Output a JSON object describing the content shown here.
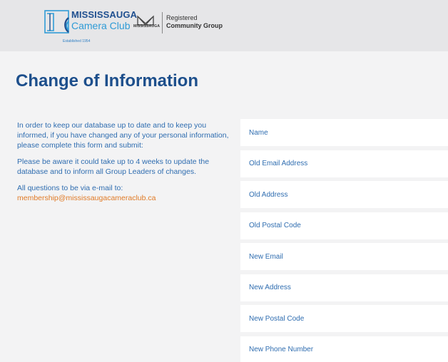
{
  "header": {
    "logo_line1": "MISSISSAUGA",
    "logo_line2": "Camera Club",
    "logo_established": "Established 1954",
    "city_logo_text": "MISSISSAUGA",
    "registered_line1": "Registered",
    "registered_line2": "Community Group"
  },
  "page": {
    "title": "Change of Information"
  },
  "intro": {
    "paragraph1": "In order to keep our database up to date and to keep you informed, if you have changed any of your personal information, please complete this form and submit:",
    "paragraph2": "Please be aware it could take up to 4 weeks to update the database and to inform all Group Leaders of changes.",
    "paragraph3": "All questions to be via e-mail to:",
    "email": "membership@mississaugacameraclub.ca"
  },
  "form": {
    "fields": [
      {
        "placeholder": "Name",
        "value": ""
      },
      {
        "placeholder": "Old Email Address",
        "value": ""
      },
      {
        "placeholder": "Old Address",
        "value": ""
      },
      {
        "placeholder": "Old Postal Code",
        "value": ""
      },
      {
        "placeholder": "New Email",
        "value": ""
      },
      {
        "placeholder": "New Address",
        "value": ""
      },
      {
        "placeholder": "New Postal Code",
        "value": ""
      },
      {
        "placeholder": "New Phone Number",
        "value": ""
      }
    ]
  },
  "colors": {
    "brand_blue": "#1d4f8c",
    "light_blue": "#2f9bd6",
    "text_blue": "#2f6db0",
    "link_orange": "#e07a26",
    "header_bg": "#e6e6e8",
    "page_bg": "#f3f3f4"
  },
  "icons": [
    "camera-club-logo-icon",
    "mississauga-city-logo-icon"
  ]
}
